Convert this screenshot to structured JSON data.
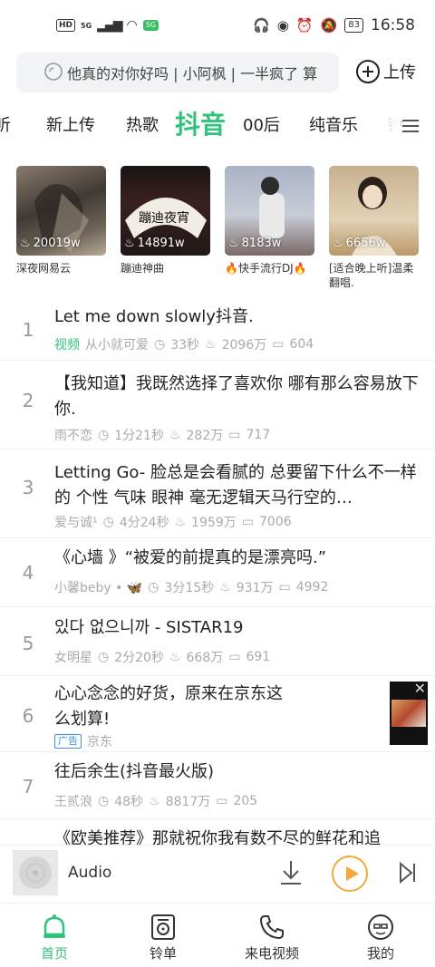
{
  "status": {
    "hd": "HD",
    "net": "5G",
    "badge": "5G\n极速",
    "battery": "83",
    "time": "16:58"
  },
  "search": {
    "placeholder": "他真的对你好吗 | 小阿枫 | 一半疯了 算",
    "upload_label": "上传"
  },
  "tabs": [
    {
      "label": "听"
    },
    {
      "label": "新上传"
    },
    {
      "label": "热歌"
    },
    {
      "label": "抖音",
      "active": true
    },
    {
      "label": "00后"
    },
    {
      "label": "纯音乐"
    },
    {
      "label": "铃"
    }
  ],
  "playlists": [
    {
      "count": "20019w",
      "title": "深夜网易云"
    },
    {
      "count": "14891w",
      "title": "蹦迪神曲"
    },
    {
      "count": "8183w",
      "title": "🔥快手流行DJ🔥"
    },
    {
      "count": "6656w",
      "title": "[适合晚上听]温柔翻唱."
    }
  ],
  "songs": [
    {
      "rank": "1",
      "title": "Let me down slowly抖音.",
      "tag": "视频",
      "artist": "从小就可爱",
      "duration": "33秒",
      "plays": "2096万",
      "comments": "604"
    },
    {
      "rank": "2",
      "title": "【我知道】我既然选择了喜欢你 哪有那么容易放下你.",
      "artist": "雨不恋",
      "duration": "1分21秒",
      "plays": "282万",
      "comments": "717"
    },
    {
      "rank": "3",
      "title": "Letting Go- 脸总是会看腻的 总要留下什么不一样的 个性 气味 眼神 毫无逻辑天马行空的…",
      "artist": "爱与诚¹",
      "duration": "4分24秒",
      "plays": "1959万",
      "comments": "7006"
    },
    {
      "rank": "4",
      "title": "《心墙 》“被爱的前提真的是漂亮吗.”",
      "artist": "小馨beby • 🦋",
      "duration": "3分15秒",
      "plays": "931万",
      "comments": "4992"
    },
    {
      "rank": "5",
      "title": "있다 없으니까 - SISTAR19",
      "artist": "女明星",
      "duration": "2分20秒",
      "plays": "668万",
      "comments": "691"
    },
    {
      "rank": "6",
      "title": "心心念念的好货，原来在京东这么划算!",
      "ad_tag": "广告",
      "artist": "京东"
    },
    {
      "rank": "7",
      "title": "往后余生(抖音最火版)",
      "artist": "王贰浪",
      "duration": "48秒",
      "plays": "8817万",
      "comments": "205"
    },
    {
      "rank": "",
      "title": "《欧美推荐》那就祝你我有数不尽的鲜花和追"
    }
  ],
  "player": {
    "label": "Audio"
  },
  "nav": [
    {
      "label": "首页",
      "icon": "home-bell-icon",
      "active": true
    },
    {
      "label": "铃单",
      "icon": "ringtone-list-icon"
    },
    {
      "label": "来电视频",
      "icon": "call-video-icon"
    },
    {
      "label": "我的",
      "icon": "profile-icon"
    }
  ],
  "colors": {
    "accent": "#31c27c",
    "play": "#f2a93b"
  }
}
